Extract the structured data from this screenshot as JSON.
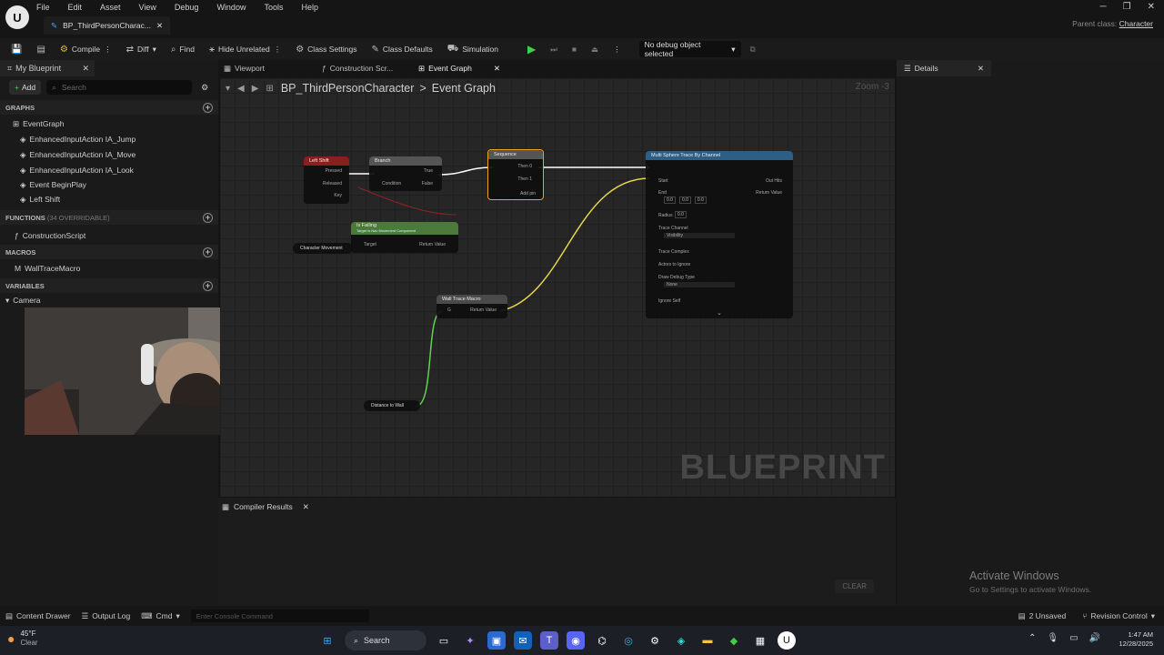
{
  "app": {
    "menu": [
      "File",
      "Edit",
      "Asset",
      "View",
      "Debug",
      "Window",
      "Tools",
      "Help"
    ],
    "document_tab": "BP_ThirdPersonCharac...",
    "parent_class_label": "Parent class:",
    "parent_class_value": "Character"
  },
  "toolbar": {
    "compile": "Compile",
    "diff": "Diff",
    "find": "Find",
    "hide_unrelated": "Hide Unrelated",
    "class_settings": "Class Settings",
    "class_defaults": "Class Defaults",
    "simulation": "Simulation",
    "debug_object": "No debug object selected"
  },
  "my_blueprint": {
    "tab": "My Blueprint",
    "add": "Add",
    "search_placeholder": "Search",
    "graphs_header": "GRAPHS",
    "graphs": [
      "EventGraph",
      "EnhancedInputAction IA_Jump",
      "EnhancedInputAction IA_Move",
      "EnhancedInputAction IA_Look",
      "Event BeginPlay",
      "Left Shift"
    ],
    "functions_header": "FUNCTIONS",
    "functions_count": "(34 OVERRIDABLE)",
    "functions": [
      "ConstructionScript"
    ],
    "macros_header": "MACROS",
    "macros": [
      "WallTraceMacro"
    ],
    "variables_header": "VARIABLES",
    "variables": [
      "Camera"
    ]
  },
  "graph_tabs": [
    "Viewport",
    "Construction Scr...",
    "Event Graph"
  ],
  "graph": {
    "breadcrumb_root": "BP_ThirdPersonCharacter",
    "breadcrumb_sep": ">",
    "breadcrumb_leaf": "Event Graph",
    "zoom": "Zoom -3",
    "watermark": "BLUEPRINT",
    "nodes": {
      "left_shift": {
        "title": "Left Shift",
        "pins": [
          "Pressed",
          "Released",
          "Key"
        ]
      },
      "branch": {
        "title": "Branch",
        "pins": [
          "True",
          "Condition",
          "False"
        ]
      },
      "sequence": {
        "title": "Sequence",
        "pins": [
          "Then 0",
          "Then 1",
          "Add pin"
        ]
      },
      "is_falling": {
        "title": "Is Falling",
        "subtitle": "Target is Nav Movement Component",
        "pins": [
          "Target",
          "Return Value"
        ]
      },
      "char_movement": {
        "title": "Character Movement"
      },
      "multi_sphere": {
        "title": "Multi Sphere Trace By Channel",
        "pins": [
          "Start",
          "End",
          "Out Hits",
          "Return Value",
          "Radius",
          "Trace Channel",
          "Visibility",
          "Trace Complex",
          "Actors to Ignore",
          "Draw Debug Type",
          "None",
          "Ignore Self"
        ],
        "values": [
          "0.0",
          "0.0",
          "0.0",
          "0.0"
        ]
      },
      "wall_trace": {
        "title": "Wall Trace Macro",
        "pins": [
          "G",
          "Return Value"
        ]
      },
      "distance": {
        "title": "Distance to Wall"
      }
    }
  },
  "compiler": {
    "tab": "Compiler Results",
    "clear": "CLEAR"
  },
  "details": {
    "tab": "Details"
  },
  "activation": {
    "line1": "Activate Windows",
    "line2": "Go to Settings to activate Windows."
  },
  "statusbar": {
    "content_drawer": "Content Drawer",
    "output_log": "Output Log",
    "cmd": "Cmd",
    "console_placeholder": "Enter Console Command",
    "unsaved": "2 Unsaved",
    "revision": "Revision Control"
  },
  "taskbar": {
    "temp": "45°F",
    "weather": "Clear",
    "search": "Search",
    "time": "1:47 AM",
    "date": "12/28/2025"
  }
}
